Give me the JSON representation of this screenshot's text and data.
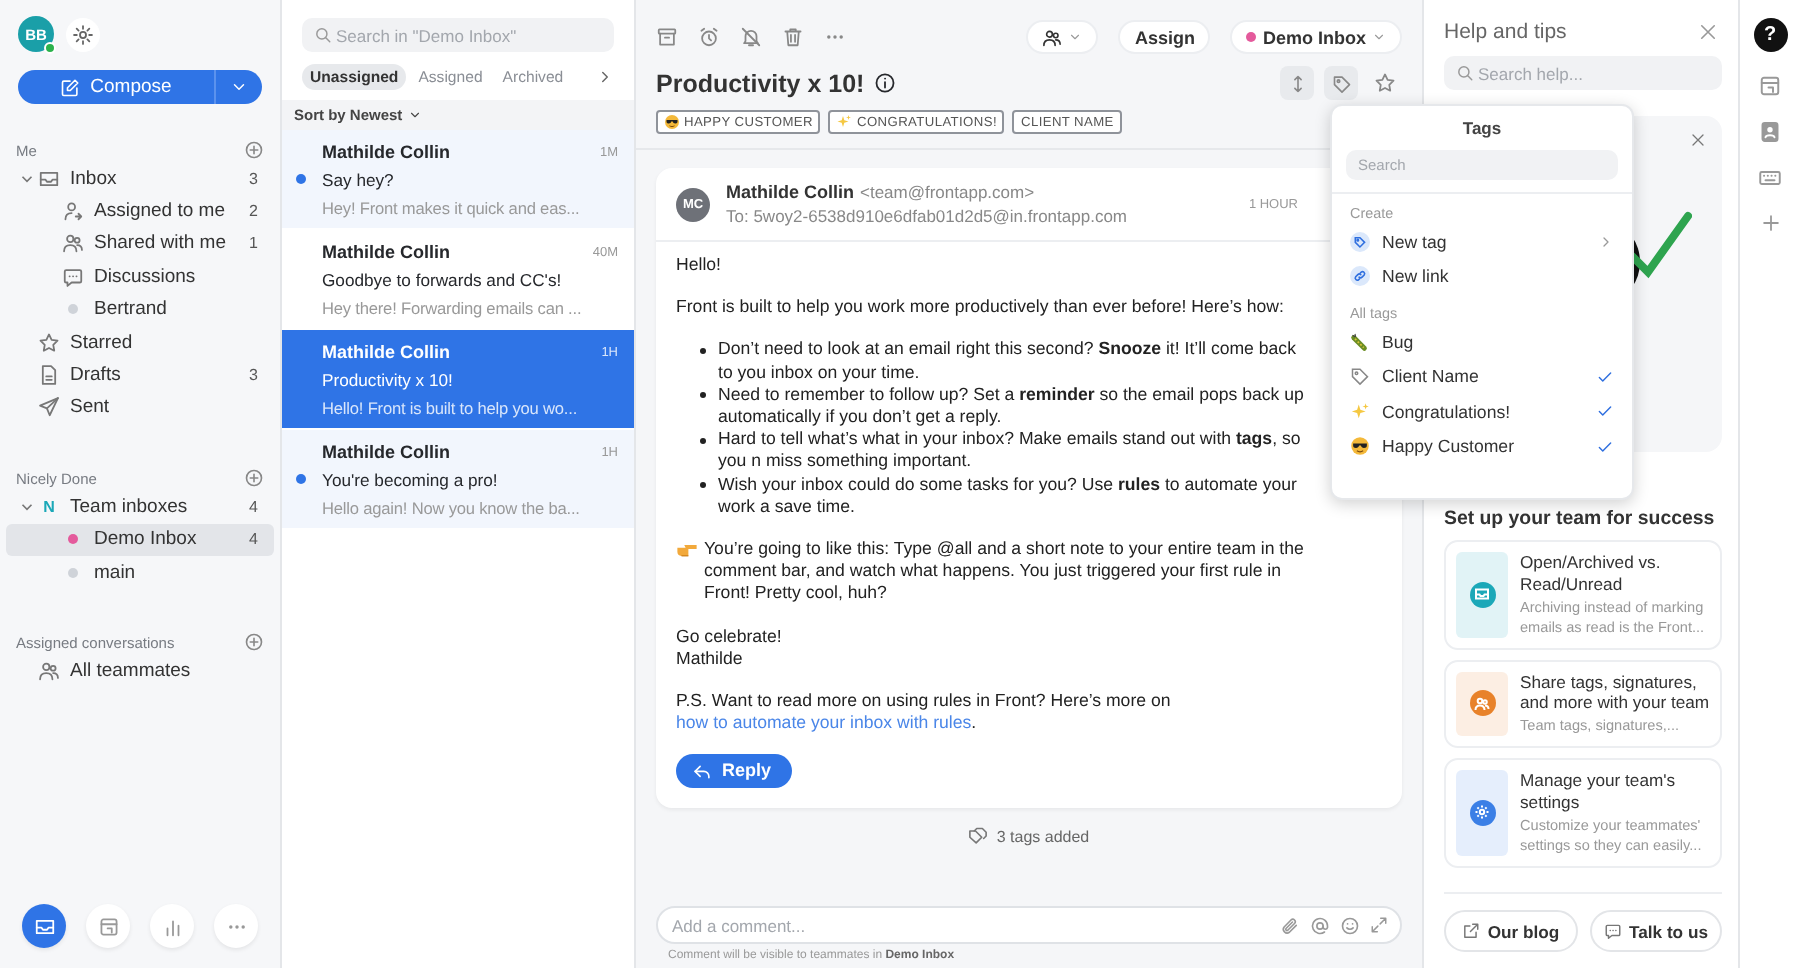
{
  "sidebar": {
    "avatar": {
      "initials": "BB",
      "online": true
    },
    "compose": "Compose",
    "sections": [
      {
        "title": "Me",
        "items": [
          {
            "kind": "inbox",
            "label": "Inbox",
            "count": "3",
            "selected": false,
            "expanded": true,
            "children": [
              {
                "kind": "assign",
                "label": "Assigned to me",
                "count": "2",
                "selected": false
              },
              {
                "kind": "people",
                "label": "Shared with me",
                "count": "1",
                "selected": false
              },
              {
                "kind": "chat",
                "label": "Discussions",
                "selected": false
              },
              {
                "kind": "dot",
                "label": "Bertrand",
                "color": "#cfd3d9",
                "selected": false
              }
            ]
          },
          {
            "kind": "star",
            "label": "Starred",
            "selected": false
          },
          {
            "kind": "draft",
            "label": "Drafts",
            "count": "3",
            "selected": false
          },
          {
            "kind": "send",
            "label": "Sent",
            "selected": false
          }
        ]
      },
      {
        "title": "Nicely Done",
        "items": [
          {
            "kind": "team",
            "badge": "N",
            "label": "Team inboxes",
            "count": "4",
            "selected": false,
            "expanded": true,
            "children": [
              {
                "kind": "dot",
                "label": "Demo Inbox",
                "count": "4",
                "color": "#e45a9c",
                "selected": true
              },
              {
                "kind": "dot",
                "label": "main",
                "color": "#cfd3d9",
                "selected": false
              }
            ]
          }
        ]
      },
      {
        "title": "Assigned conversations",
        "items": [
          {
            "kind": "people",
            "label": "All teammates",
            "selected": false
          }
        ]
      }
    ],
    "nav": [
      {
        "kind": "inbox",
        "selected": true
      },
      {
        "kind": "calendar",
        "selected": false
      },
      {
        "kind": "chart",
        "selected": false
      },
      {
        "kind": "more",
        "selected": false
      }
    ]
  },
  "list": {
    "placeholder": "Search in \"Demo Inbox\"",
    "tabs": [
      {
        "label": "Unassigned",
        "selected": true
      },
      {
        "label": "Assigned",
        "selected": false
      },
      {
        "label": "Archived",
        "selected": false
      }
    ],
    "sort": "Sort by Newest",
    "conversations": [
      {
        "sender": "Mathilde Collin",
        "time": "1M",
        "subject": "Say hey?",
        "preview": "Hey! Front makes it quick and eas...",
        "unread": true,
        "selected": false
      },
      {
        "sender": "Mathilde Collin",
        "time": "40M",
        "subject": "Goodbye to forwards and CC's!",
        "preview": "Hey there! Forwarding emails can ...",
        "unread": false,
        "selected": false
      },
      {
        "sender": "Mathilde Collin",
        "time": "1H",
        "subject": "Productivity x 10!",
        "preview": "Hello! Front is built to help you wo...",
        "unread": false,
        "selected": true
      },
      {
        "sender": "Mathilde Collin",
        "time": "1H",
        "subject": "You're becoming a pro!",
        "preview": "Hello again! Now you know the ba...",
        "unread": true,
        "selected": false
      }
    ]
  },
  "main": {
    "assign": "Assign",
    "inbox": {
      "label": "Demo Inbox",
      "color": "#e45a9c"
    },
    "subject": "Productivity x 10!",
    "tags": [
      {
        "kind": "sunglasses",
        "label": "HAPPY CUSTOMER"
      },
      {
        "kind": "sparkle",
        "label": "CONGRATULATIONS!"
      },
      {
        "kind": "plain",
        "label": "CLIENT NAME"
      }
    ],
    "message": {
      "initials": "MC",
      "sender": "Mathilde Collin",
      "address": "<team@frontapp.com>",
      "to": "To: 5woy2-6538d910e6dfab01d2d5@in.frontapp.com",
      "time": "1 HOUR",
      "blocks": [
        {
          "kind": "para",
          "text": "Hello!"
        },
        {
          "kind": "para",
          "text": "Front is built to help you work more productively than ever before! Here’s how:"
        },
        {
          "kind": "bullets",
          "items": [
            "Don’t need to look at an email right this second? **Snooze** it! It’ll come back to you inbox on your time.",
            "Need to remember to follow up? Set a **reminder** so the email pops back up automatically if you don’t get a reply.",
            "Hard to tell what’s what in your inbox? Make emails stand out with **tags**, so you n miss something important.",
            "Wish your inbox could do some tasks for you? Use **rules** to automate your work a save time."
          ]
        },
        {
          "kind": "note",
          "text": "You’re going to like this: Type @all and a short note to your entire team in the comment bar, and watch what happens. You just triggered your first rule in Front! Pretty cool, huh?"
        },
        {
          "kind": "lines",
          "items": [
            "Go celebrate!",
            "Mathilde"
          ]
        },
        {
          "kind": "link",
          "text": "P.S. Want to read more on using rules in Front? Here’s more on",
          "link": "how to automate your inbox with rules",
          "after": "."
        }
      ],
      "reply": "Reply"
    },
    "activity": "3 tags added",
    "comment": {
      "placeholder": "Add a comment...",
      "note": "Comment will be visible to teammates in **Demo Inbox**"
    }
  },
  "tags_menu": {
    "title": "Tags",
    "placeholder": "Search",
    "groups": [
      {
        "label": "Create",
        "items": [
          {
            "kind": "new-tag",
            "label": "New tag",
            "submenu": true
          },
          {
            "kind": "link",
            "label": "New link",
            "submenu": false
          }
        ]
      },
      {
        "label": "All tags",
        "items": [
          {
            "kind": "bug",
            "label": "Bug",
            "checked": false
          },
          {
            "kind": "tag",
            "label": "Client Name",
            "checked": true
          },
          {
            "kind": "sparkle",
            "label": "Congratulations!",
            "checked": true
          },
          {
            "kind": "sunglasses",
            "label": "Happy Customer",
            "checked": true
          }
        ]
      }
    ]
  },
  "help": {
    "title": "Help and tips",
    "placeholder": "Search help...",
    "heading": "Set up your team for success",
    "cards": [
      {
        "kind": "inbox",
        "color": "#1ba8b8",
        "title": "Open/Archived vs. Read/Unread",
        "description": "Archiving instead of marking emails as read is the Front..."
      },
      {
        "kind": "team",
        "color": "#e8822a",
        "title": "Share tags, signatures, and more with your team",
        "description": "Team tags, signatures,..."
      },
      {
        "kind": "gear",
        "color": "#3b7fe6",
        "title": "Manage your team's settings",
        "description": "Customize your teammates' settings so they can easily..."
      }
    ],
    "buttons": [
      {
        "kind": "external",
        "label": "Our blog"
      },
      {
        "kind": "chat",
        "label": "Talk to us"
      }
    ]
  },
  "rail": {
    "help": "?"
  }
}
